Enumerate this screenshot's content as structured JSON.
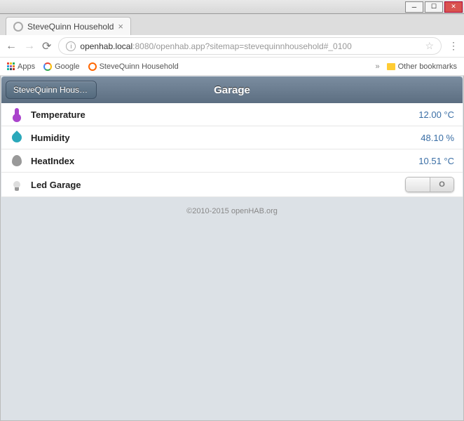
{
  "window": {
    "tab_title": "SteveQuinn Household",
    "url_host": "openhab.local",
    "url_port": ":8080",
    "url_path": "/openhab.app?sitemap=stevequinnhousehold#_0100"
  },
  "bookmarks": {
    "apps_label": "Apps",
    "items": [
      "Google",
      "SteveQuinn Household"
    ],
    "other_label": "Other bookmarks",
    "chevron": "»"
  },
  "app": {
    "back_label": "SteveQuinn House…",
    "title": "Garage"
  },
  "rows": [
    {
      "icon": "thermometer-icon",
      "label": "Temperature",
      "value": "12.00 °C"
    },
    {
      "icon": "droplet-icon",
      "label": "Humidity",
      "value": "48.10 %"
    },
    {
      "icon": "flame-icon",
      "label": "HeatIndex",
      "value": "10.51 °C"
    }
  ],
  "switch_row": {
    "icon": "bulb-icon",
    "label": "Led Garage",
    "on_label": "",
    "off_label": "O"
  },
  "footer": "©2010-2015 openHAB.org"
}
